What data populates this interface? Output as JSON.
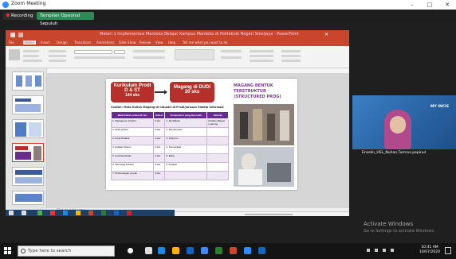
{
  "zoom": {
    "window_title": "Zoom Meeting",
    "recording_label": "Recording",
    "view_options_label": "Tampilan Opsional Sepuluh"
  },
  "ppt": {
    "window_title": "Materi 1 Implementasi Merdeka Belajar Kampus Merdeka di Politeknik Negeri Sriwijaya - PowerPoint",
    "tabs": [
      "File",
      "Home",
      "Insert",
      "Design",
      "Transitions",
      "Animations",
      "Slide Show",
      "Review",
      "View",
      "Help",
      "Tell me what you want to do"
    ],
    "notes_placeholder": "Click to add notes",
    "slide": {
      "box1_line1": "Kurikulum Prodi",
      "box1_line2": "D & ST",
      "box1_line3": "144 sks",
      "box2_line1": "Magang di DUDI",
      "box2_line2": "20 sks",
      "right_title_line1": "MAGANG BENTUK",
      "right_title_line2": "TERSTRUKTUR",
      "right_title_line3": "(STRUCTURED PROG)",
      "subtitle": "Contoh: Mata Kuliah Magang di Industri di Prodi/Jurusan Sistem Informasi",
      "table_headers": [
        "Mata Kuliah setara 20 sks",
        "Bobot",
        "Kompetensi yang diperoleh",
        "Metode"
      ],
      "table_rows": [
        [
          "1. Manajemen Industri",
          "3 sks",
          "1. Identifikasi",
          "Problem Based Learning"
        ],
        [
          "2. Etika profesi",
          "2 sks",
          "2. Kemampuan",
          ""
        ],
        [
          "3. Kerja Praktek",
          "4 sks",
          "3. Kerja tim",
          ""
        ],
        [
          "4. Analisis Sistem",
          "3 sks",
          "4. Komunikasi",
          ""
        ],
        [
          "5. Kewirausahaan",
          "2 sks",
          "5. Etika",
          ""
        ],
        [
          "6. Teknologi Industri",
          "3 sks",
          "6. Analisis",
          ""
        ],
        [
          "7. Perancangan proyek",
          "3 sks",
          "",
          ""
        ]
      ]
    }
  },
  "video": {
    "participant_name": "Enselin_HSL_Nuhan.Tumrus.pepinul",
    "tile_label": "MY INCIS"
  },
  "watermark": {
    "line1": "Activate Windows",
    "line2": "Go to Settings to activate Windows."
  },
  "taskbar": {
    "search_placeholder": "Type here to search",
    "time": "10:41 AM",
    "date": "10/07/2020"
  },
  "colors": {
    "ppt_accent": "#c8462b",
    "slide_red": "#b5302a",
    "title_purple": "#7b3a8e",
    "table_header": "#6a2c8a"
  }
}
